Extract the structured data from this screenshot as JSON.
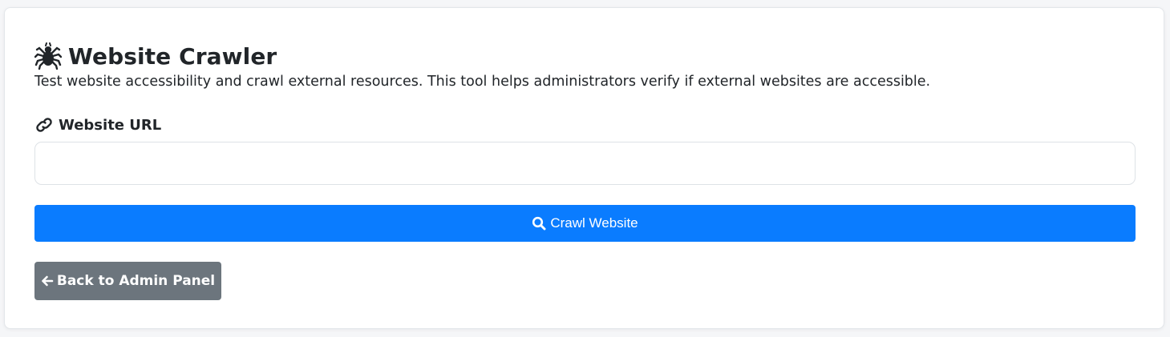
{
  "header": {
    "title_icon": "spider-icon",
    "title": "Website Crawler",
    "description": "Test website accessibility and crawl external resources. This tool helps administrators verify if external websites are accessible."
  },
  "form": {
    "url_label_icon": "link-icon",
    "url_label": "Website URL",
    "url_value": "",
    "url_placeholder": "",
    "submit_icon": "search-icon",
    "submit_label": "Crawl Website",
    "submit_color": "#0a7cff"
  },
  "navigation": {
    "back_icon": "arrow-left-icon",
    "back_label": "Back to Admin Panel",
    "back_color": "#6c757d"
  }
}
